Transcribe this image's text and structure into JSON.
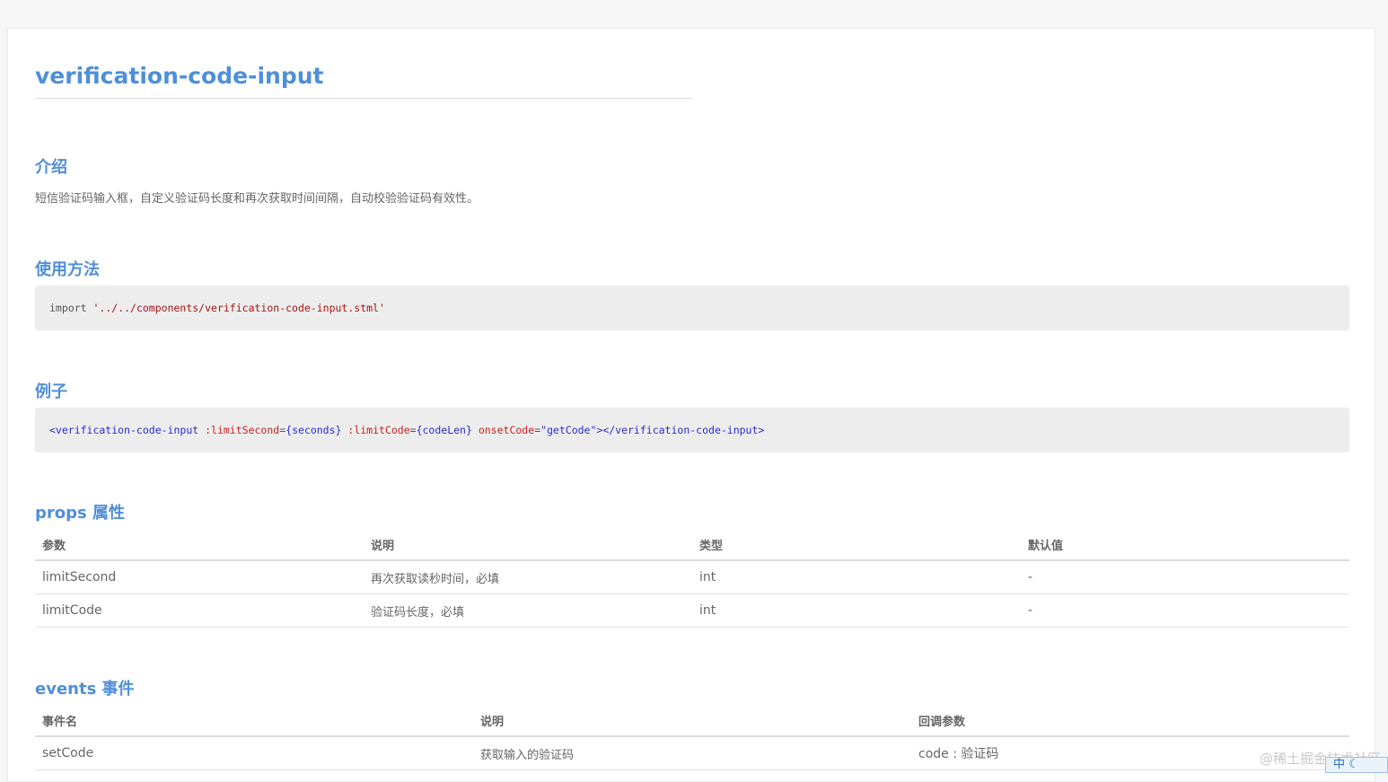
{
  "doc": {
    "title": "verification-code-input",
    "intro": {
      "heading": "介绍",
      "text": "短信验证码输入框，自定义验证码长度和再次获取时间间隔，自动校验验证码有效性。"
    },
    "usage": {
      "heading": "使用方法",
      "code_keyword": "import",
      "code_string": "'../../components/verification-code-input.stml'"
    },
    "example": {
      "heading": "例子",
      "code": {
        "open": "<verification-code-input",
        "attr1": ":limitSecond",
        "eq1": "=",
        "val1": "{seconds}",
        "attr2": ":limitCode",
        "eq2": "=",
        "val2": "{codeLen}",
        "attr3": "onsetCode",
        "eq3": "=",
        "val3": "\"getCode\"",
        "close": "></verification-code-input>"
      }
    },
    "props": {
      "heading": "props 属性",
      "headers": [
        "参数",
        "说明",
        "类型",
        "默认值"
      ],
      "rows": [
        [
          "limitSecond",
          "再次获取读秒时间，必填",
          "int",
          "-"
        ],
        [
          "limitCode",
          "验证码长度，必填",
          "int",
          "-"
        ]
      ]
    },
    "events": {
      "heading": "events 事件",
      "headers": [
        "事件名",
        "说明",
        "回调参数"
      ],
      "rows": [
        [
          "setCode",
          "获取输入的验证码",
          "code : 验证码"
        ]
      ]
    }
  },
  "watermark": "@稀土掘金技术社区",
  "tray": {
    "ime_label": "中",
    "moon_icon": "moon-icon"
  }
}
